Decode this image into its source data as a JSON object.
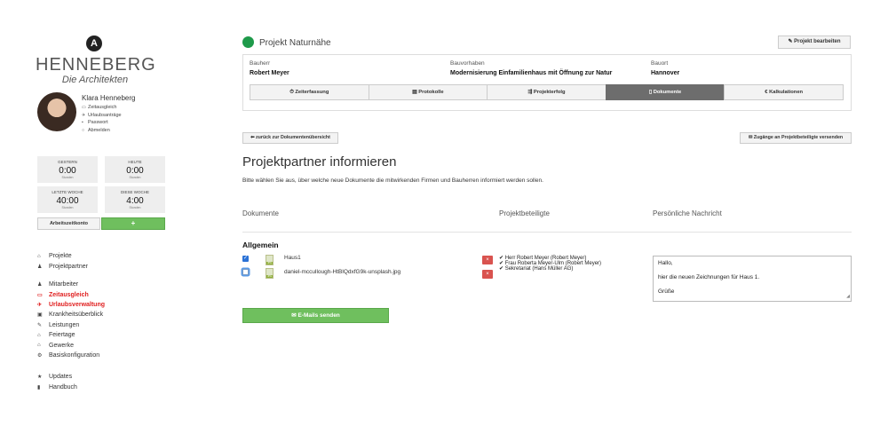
{
  "brand": {
    "logo_mark": "A",
    "name": "HENNEBERG",
    "subtitle": "Die Architekten"
  },
  "user": {
    "name": "Klara Henneberg",
    "links": [
      {
        "icon": "clock-card-icon",
        "glyph": "▭",
        "label": "Zeitausgleich"
      },
      {
        "icon": "plane-icon",
        "glyph": "✈",
        "label": "Urlaubsanträge"
      },
      {
        "icon": "lock-icon",
        "glyph": "▪",
        "label": "Passwort"
      },
      {
        "icon": "logout-icon",
        "glyph": "○",
        "label": "Abmelden"
      }
    ]
  },
  "stats": [
    {
      "label": "Gestern",
      "value": "0:00",
      "unit": "Stunden"
    },
    {
      "label": "Heute",
      "value": "0:00",
      "unit": "Stunden"
    },
    {
      "label": "Letzte Woche",
      "value": "40:00",
      "unit": "Stunden"
    },
    {
      "label": "Diese Woche",
      "value": "4:00",
      "unit": "Stunden"
    }
  ],
  "stat_buttons": {
    "account": "Arbeitszeitkonto",
    "add": "+"
  },
  "nav": {
    "group1": [
      {
        "icon": "home-icon",
        "glyph": "⌂",
        "label": "Projekte",
        "active": false
      },
      {
        "icon": "users-icon",
        "glyph": "♟",
        "label": "Projektpartner",
        "active": false
      }
    ],
    "group2": [
      {
        "icon": "user-icon",
        "glyph": "♟",
        "label": "Mitarbeiter",
        "active": false
      },
      {
        "icon": "clock-card-icon",
        "glyph": "▭",
        "label": "Zeitausgleich",
        "active": true
      },
      {
        "icon": "plane-icon",
        "glyph": "✈",
        "label": "Urlaubsverwaltung",
        "active": true
      },
      {
        "icon": "briefcase-icon",
        "glyph": "▣",
        "label": "Krankheitsüberblick",
        "active": false
      },
      {
        "icon": "wrench-icon",
        "glyph": "✎",
        "label": "Leistungen",
        "active": false
      },
      {
        "icon": "home-icon",
        "glyph": "⌂",
        "label": "Feiertage",
        "active": false
      },
      {
        "icon": "home-icon",
        "glyph": "⌂",
        "label": "Gewerke",
        "active": false
      },
      {
        "icon": "gear-icon",
        "glyph": "⚙",
        "label": "Basiskonfiguration",
        "active": false
      }
    ],
    "group3": [
      {
        "icon": "star-icon",
        "glyph": "★",
        "label": "Updates",
        "active": false
      },
      {
        "icon": "book-icon",
        "glyph": "▮",
        "label": "Handbuch",
        "active": false
      }
    ]
  },
  "project": {
    "title": "Projekt Naturnähe",
    "status_color": "#1e9a4a",
    "edit_button": "✎ Projekt bearbeiten",
    "fields": [
      {
        "key": "Bauherr",
        "value": "Robert Meyer"
      },
      {
        "key": "Bauvorhaben",
        "value": "Modernisierung Einfamilienhaus mit Öffnung zur Natur"
      },
      {
        "key": "Bauort",
        "value": "Hannover"
      }
    ],
    "tabs": [
      {
        "label": "⏱ Zeiterfassung",
        "active": false
      },
      {
        "label": "▤ Protokolle",
        "active": false
      },
      {
        "label": "⇶ Projekterfolg",
        "active": false
      },
      {
        "label": "▯ Dokumente",
        "active": true
      },
      {
        "label": "€ Kalkulationen",
        "active": false
      }
    ]
  },
  "page": {
    "back_button": "⬅ zurück zur Dokumentenübersicht",
    "send_access_button": "✉ Zugänge an Projektbeteiligte versenden",
    "heading": "Projektpartner informieren",
    "intro": "Bitte wählen Sie aus, über welche neue Dokumente die mitwirkenden Firmen und Bauherren informiert werden sollen.",
    "columns": {
      "documents": "Dokumente",
      "participants": "Projektbeteiligte",
      "message": "Persönliche Nachricht"
    },
    "group": "Allgemein",
    "files": [
      {
        "name": "Haus1",
        "checked": true
      },
      {
        "name": "daniel-mccullough-HtBlQdxfG9k-unsplash.jpg",
        "checked": false
      }
    ],
    "participants": [
      "✔ Herr Robert Meyer (Robert Meyer)",
      "✔ Frau Roberta Meyer-Ulm (Robert Meyer)",
      "✔ Sekretariat (Hans Müller AG)"
    ],
    "remove_glyph": "×",
    "message_lines": [
      "Hallo,",
      "hier die neuen Zeichnungen für Haus 1.",
      "Grüße"
    ],
    "send_button": "✉ E-Mails senden"
  }
}
